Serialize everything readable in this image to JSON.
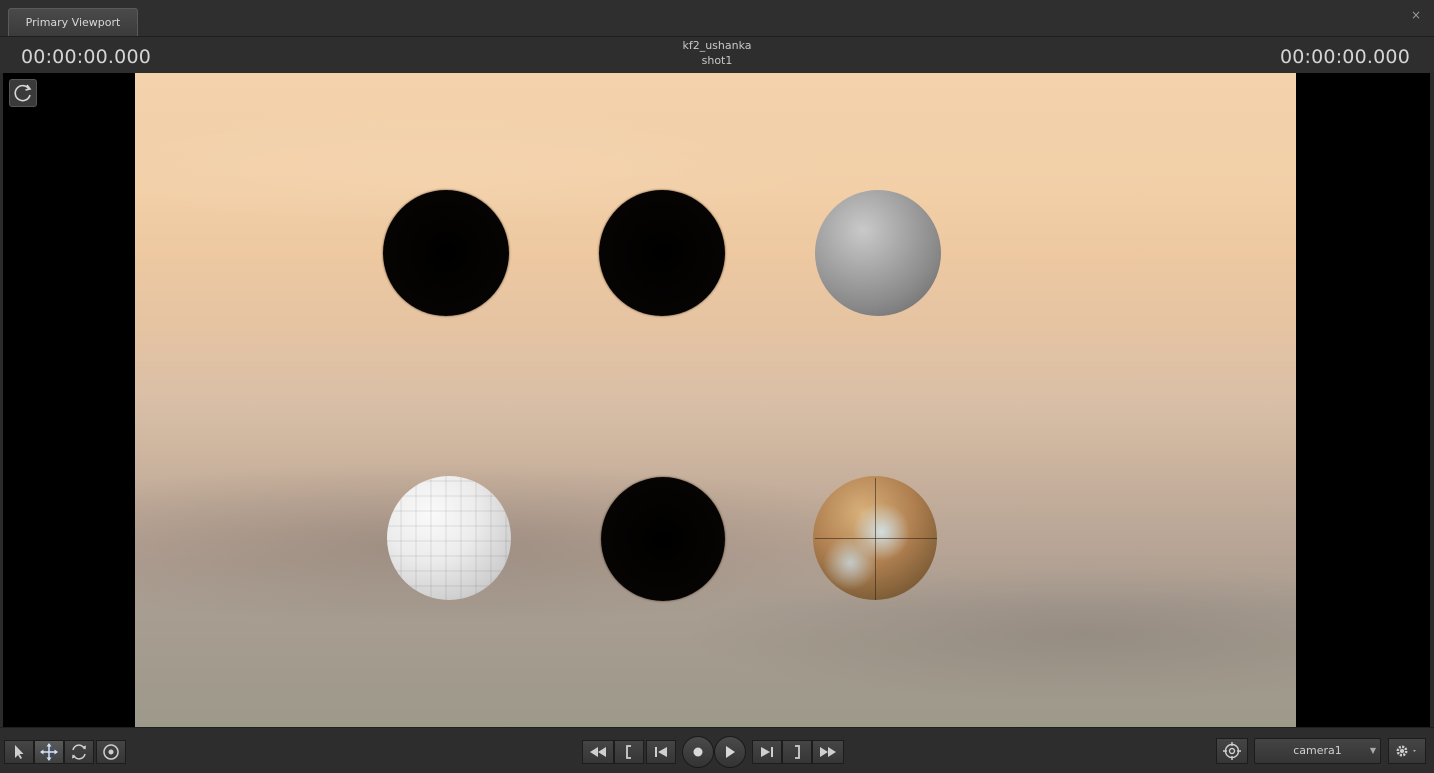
{
  "window": {
    "tab_label": "Primary Viewport",
    "close_glyph": "×"
  },
  "info": {
    "timecode_left": "00:00:00.000",
    "timecode_right": "00:00:00.000",
    "scene_name": "kf2_ushanka",
    "shot_name": "shot1"
  },
  "viewport": {
    "spheres": [
      "black",
      "black",
      "grey-stone",
      "white-faceted",
      "black",
      "earth-texture"
    ]
  },
  "toolbar": {
    "tools": [
      "select-icon",
      "move-icon",
      "orbit-icon",
      "target-icon"
    ],
    "transport": [
      "rewind-icon",
      "mark-in-icon",
      "step-back-icon",
      "record-icon",
      "play-icon",
      "step-forward-icon",
      "mark-out-icon",
      "fast-forward-icon"
    ],
    "camera_value": "camera1",
    "accent_color": "#cfe3ff"
  }
}
